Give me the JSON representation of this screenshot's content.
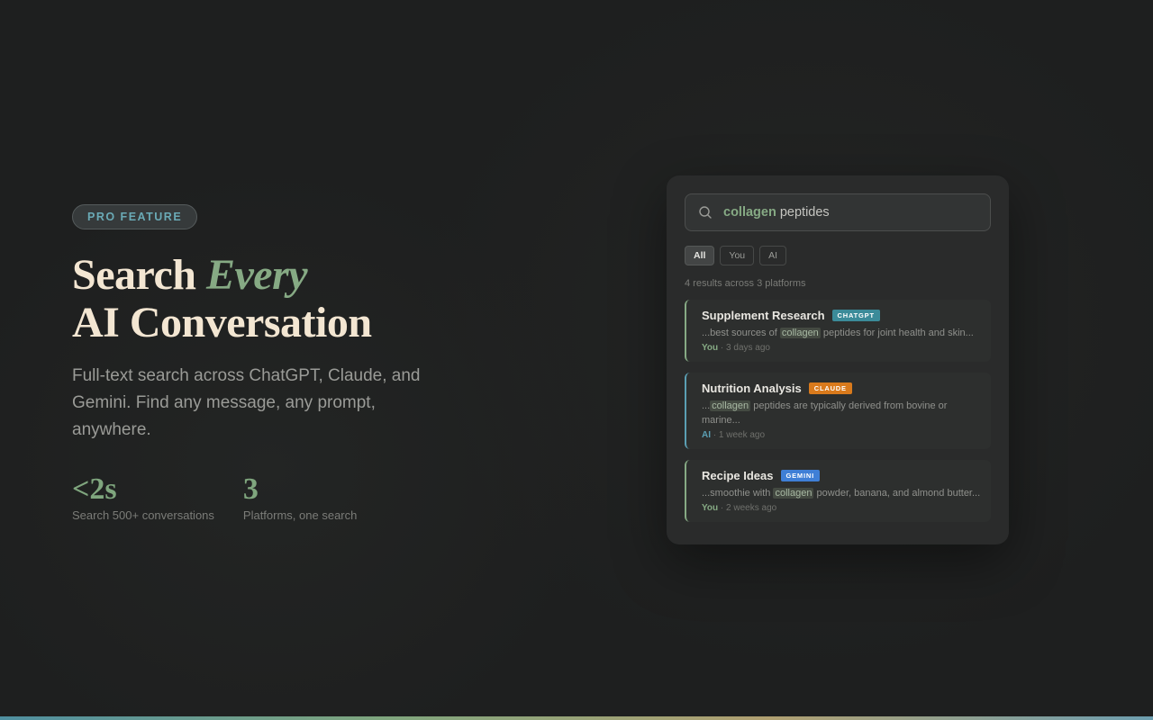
{
  "hero": {
    "badge": "PRO FEATURE",
    "headline_part1": "Search ",
    "headline_accent": "Every",
    "headline_line2": "AI Conversation",
    "subtext": "Full-text search across ChatGPT, Claude, and Gemini. Find any message, any prompt, anywhere.",
    "stats": [
      {
        "value": "<2s",
        "label": "Search 500+ conversations"
      },
      {
        "value": "3",
        "label": "Platforms, one search"
      }
    ]
  },
  "search": {
    "icon": "search-icon",
    "highlight_term": "collagen",
    "rest_query": " peptides"
  },
  "filters": [
    {
      "label": "All",
      "active": true
    },
    {
      "label": "You",
      "active": false
    },
    {
      "label": "AI",
      "active": false
    }
  ],
  "results_summary": "4 results across 3 platforms",
  "results": [
    {
      "title": "Supplement Research",
      "tag": "CHATGPT",
      "tag_color": "#3b8b99",
      "snippet_pre": "...best sources of ",
      "snippet_hl": "collagen",
      "snippet_post": " peptides for joint health and skin...",
      "author": "You",
      "time": " · 3 days ago"
    },
    {
      "title": "Nutrition Analysis",
      "tag": "CLAUDE",
      "tag_color": "#d97a1c",
      "snippet_pre": "...",
      "snippet_hl": "collagen",
      "snippet_post": " peptides are typically derived from bovine or marine...",
      "author": "AI",
      "time": " · 1 week ago"
    },
    {
      "title": "Recipe Ideas",
      "tag": "GEMINI",
      "tag_color": "#3f7fd6",
      "snippet_pre": "...smoothie with ",
      "snippet_hl": "collagen",
      "snippet_post": " powder, banana, and almond butter...",
      "author": "You",
      "time": " · 2 weeks ago"
    }
  ],
  "colors": {
    "accent_green": "#86aa84",
    "accent_teal": "#5b9fb3",
    "headline": "#f3e6d2",
    "background": "#1e1f1f"
  }
}
